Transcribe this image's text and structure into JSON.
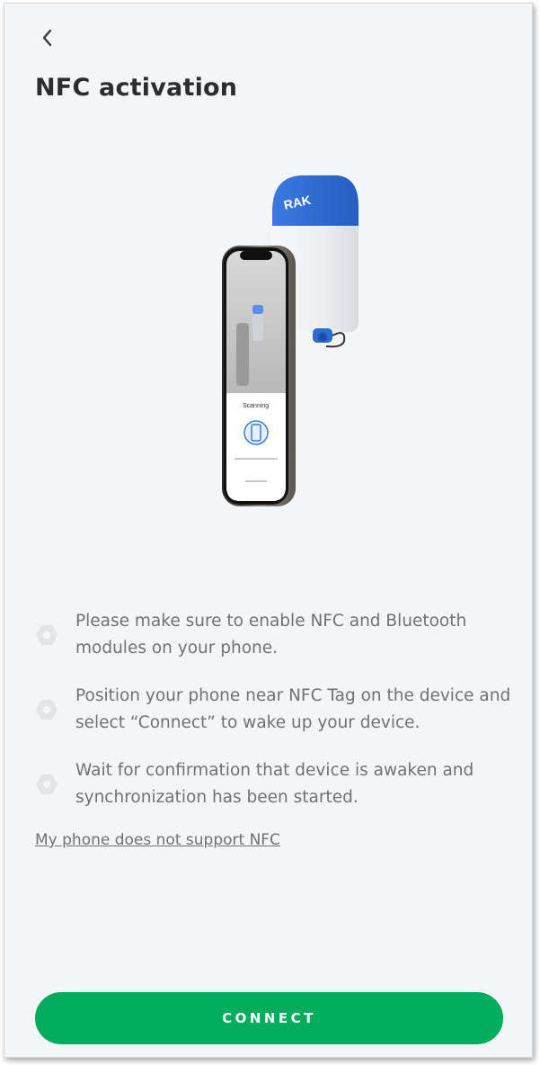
{
  "header": {
    "back_icon": "chevron-left-icon",
    "title": "NFC activation"
  },
  "illustration": {
    "device_brand": "RAK",
    "phone_status": "Scanning",
    "colors": {
      "device_cap": "#2f6fd6",
      "device_body": "#eceef1",
      "phone_frame": "#6b6760"
    }
  },
  "steps": [
    {
      "icon": "hexagon-bullet-icon",
      "text": "Please make sure to enable NFC and Bluetooth modules on your phone."
    },
    {
      "icon": "hexagon-bullet-icon",
      "text": "Position your phone near NFC Tag on the device and select “Connect” to wake up your device."
    },
    {
      "icon": "hexagon-bullet-icon",
      "text": "Wait for confirmation that device is awaken and synchronization has been started."
    }
  ],
  "link": {
    "label": "My phone does not support NFC"
  },
  "action": {
    "connect_label": "CONNECT",
    "color": "#00ad5a"
  }
}
